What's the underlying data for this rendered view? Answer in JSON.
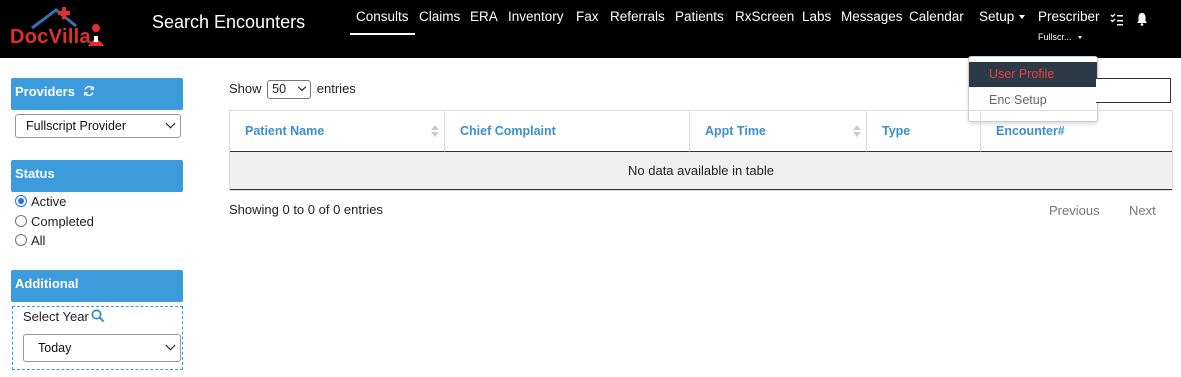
{
  "app": {
    "logo_text": "DocVilla",
    "page_title": "Search Encounters"
  },
  "nav": {
    "items": [
      {
        "label": "Consults",
        "active": true
      },
      {
        "label": "Claims"
      },
      {
        "label": "ERA"
      },
      {
        "label": "Inventory"
      },
      {
        "label": "Fax"
      },
      {
        "label": "Referrals"
      },
      {
        "label": "Patients"
      },
      {
        "label": "RxScreen"
      },
      {
        "label": "Labs"
      },
      {
        "label": "Messages"
      },
      {
        "label": "Calendar"
      }
    ],
    "setup_label": "Setup",
    "prescriber_label": "Prescriber",
    "prescriber_sub": "Fullscr...",
    "icons": [
      "checklist-icon",
      "bell-icon"
    ]
  },
  "setup_menu": {
    "items": [
      "User Profile",
      "Enc Setup"
    ],
    "selected": "User Profile"
  },
  "sidebar": {
    "providers": {
      "title": "Providers",
      "refresh_icon": "refresh-icon",
      "selected": "Fullscript Provider"
    },
    "status": {
      "title": "Status",
      "options": [
        "Active",
        "Completed",
        "All"
      ],
      "selected": "Active"
    },
    "additional": {
      "title": "Additional",
      "year_label": "Select Year",
      "search_icon": "search-icon",
      "year_selected": "Today"
    }
  },
  "table": {
    "show_label": "Show",
    "entries_label": "entries",
    "page_size": "50",
    "columns": [
      "Patient Name",
      "Chief Complaint",
      "Appt Time",
      "Type",
      "Encounter#"
    ],
    "empty_message": "No data available in table",
    "info": "Showing 0 to 0 of 0 entries",
    "prev_label": "Previous",
    "next_label": "Next"
  },
  "colors": {
    "navbar": "#000000",
    "accent": "#3b9bdb",
    "brand_red": "#e0302d",
    "menu_selected_bg": "#2c3a47"
  }
}
